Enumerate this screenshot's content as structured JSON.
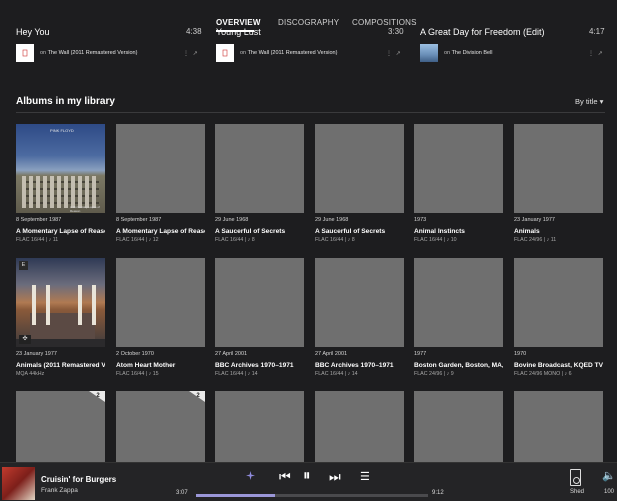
{
  "nav": {
    "tabs": [
      "OVERVIEW",
      "DISCOGRAPHY",
      "COMPOSITIONS"
    ],
    "active": 0
  },
  "top_tracks": [
    {
      "title": "Hey You",
      "duration": "4:38",
      "on": "on",
      "album": "The Wall (2011 Remastered Version)"
    },
    {
      "title": "Young Lust",
      "duration": "3:30",
      "on": "on",
      "album": "The Wall (2011 Remastered Version)"
    },
    {
      "title": "A Great Day for Freedom (Edit)",
      "duration": "4:17",
      "on": "on",
      "album": "The Division Bell"
    }
  ],
  "section": {
    "title": "Albums in my library",
    "sort": "By title"
  },
  "albums": [
    {
      "date": "8 September 1987",
      "title": "A Momentary Lapse of Reaso",
      "format": "FLAC 16/44 | ♪ 11",
      "cover": "lapse",
      "logo": "PINK FLOYD",
      "sub": "A Momentary Lapse of Reason"
    },
    {
      "date": "8 September 1987",
      "title": "A Momentary Lapse of Reaso",
      "format": "FLAC 16/44 | ♪ 12"
    },
    {
      "date": "29 June 1968",
      "title": "A Saucerful of Secrets",
      "format": "FLAC 16/44 | ♪ 8"
    },
    {
      "date": "29 June 1968",
      "title": "A Saucerful of Secrets",
      "format": "FLAC 16/44 | ♪ 8"
    },
    {
      "date": "1973",
      "title": "Animal Instincts",
      "format": "FLAC 16/44 | ♪ 10"
    },
    {
      "date": "23 January 1977",
      "title": "Animals",
      "format": "FLAC 24/96 | ♪ 11"
    },
    {
      "date": "23 January 1977",
      "title": "Animals (2011 Remastered Ve",
      "format": "MQA 44kHz",
      "cover": "animals",
      "badge_e": "E",
      "badge_mqa": "✣"
    },
    {
      "date": "2 October 1970",
      "title": "Atom Heart Mother",
      "format": "FLAC 16/44 | ♪ 15"
    },
    {
      "date": "27 April 2001",
      "title": "BBC Archives 1970–1971",
      "format": "FLAC 16/44 | ♪ 14"
    },
    {
      "date": "27 April 2001",
      "title": "BBC Archives 1970–1971",
      "format": "FLAC 16/44 | ♪ 14"
    },
    {
      "date": "1977",
      "title": "Boston Garden, Boston, MA,",
      "format": "FLAC 24/96 | ♪ 9"
    },
    {
      "date": "1970",
      "title": "Bovine Broadcast, KQED TV",
      "format": "FLAC 24/96 MONO | ♪ 6"
    },
    {
      "badge": "2"
    },
    {
      "badge": "2"
    },
    {},
    {},
    {},
    {}
  ],
  "player": {
    "title": "Cruisin' for Burgers",
    "artist": "Frank Zappa",
    "elapsed": "3:07",
    "total": "9:12",
    "progress": 0.34,
    "zone": "Shed",
    "volume": "100"
  },
  "colors": {
    "background": "#1d1d1f",
    "accent": "#9b97d8"
  }
}
